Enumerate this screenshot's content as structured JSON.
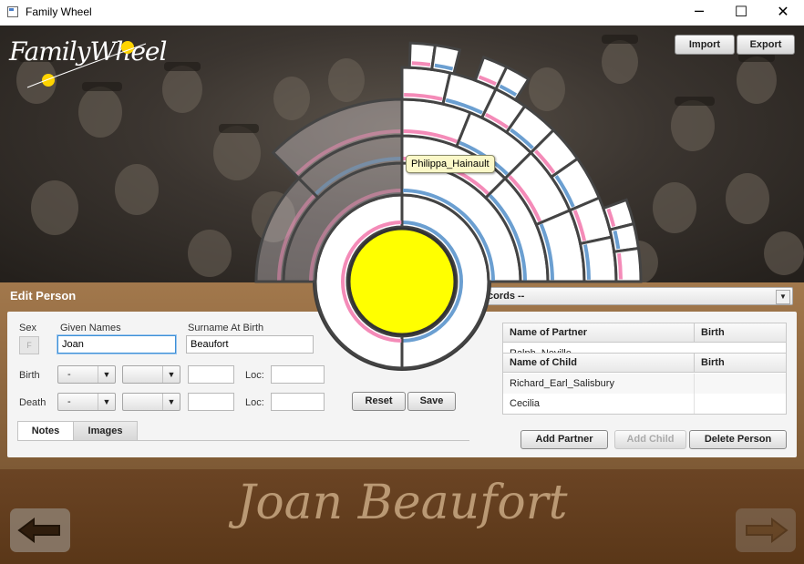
{
  "window": {
    "title": "Family Wheel",
    "minimize": "─",
    "maximize": "☐",
    "close": "✕"
  },
  "header": {
    "logo_text": "FamilyWheel",
    "import_label": "Import",
    "export_label": "Export"
  },
  "wheel": {
    "center_color": "#ffff00",
    "male_color": "#6b9fd1",
    "female_color": "#f48bb8",
    "tooltip": "Philippa_Hainault"
  },
  "edit_person": {
    "title": "Edit Person",
    "sex_label": "Sex",
    "sex_value": "F",
    "given_names_label": "Given Names",
    "given_names_value": "Joan",
    "surname_label": "Surname At Birth",
    "surname_value": "Beaufort",
    "birth_label": "Birth",
    "death_label": "Death",
    "loc_label": "Loc:",
    "combo_value": "-",
    "reset_label": "Reset",
    "save_label": "Save",
    "tabs": [
      {
        "label": "Notes"
      },
      {
        "label": "Images"
      }
    ],
    "records_combo": "cords --",
    "partners_table": {
      "headers": [
        "Name of Partner",
        "Birth"
      ],
      "rows": [
        [
          "Ralph_Neville",
          ""
        ]
      ]
    },
    "children_table": {
      "headers": [
        "Name of Child",
        "Birth"
      ],
      "rows": [
        [
          "Richard_Earl_Salisbury",
          ""
        ],
        [
          "Cecilia",
          ""
        ]
      ]
    },
    "add_partner_label": "Add Partner",
    "add_child_label": "Add Child",
    "delete_person_label": "Delete Person"
  },
  "footer": {
    "person_name": "Joan Beaufort",
    "back_icon": "arrow-left-icon",
    "forward_icon": "arrow-right-icon"
  }
}
